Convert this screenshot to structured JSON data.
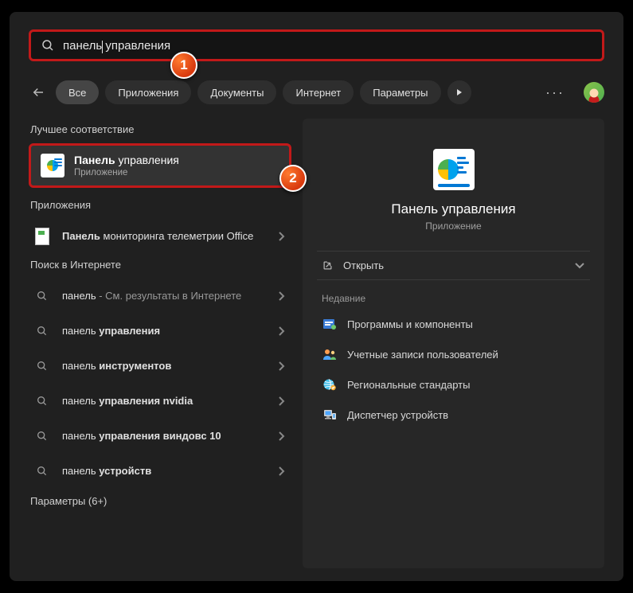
{
  "search": {
    "query_prefix": "панель",
    "query_suffix": " управления"
  },
  "tabs": {
    "all": "Все",
    "apps": "Приложения",
    "docs": "Документы",
    "web": "Интернет",
    "settings": "Параметры"
  },
  "sections": {
    "best": "Лучшее соответствие",
    "apps": "Приложения",
    "web": "Поиск в Интернете",
    "settings_count": "Параметры (6+)"
  },
  "best_match": {
    "title_bold": "Панель",
    "title_rest": " управления",
    "subtitle": "Приложение"
  },
  "apps_results": [
    {
      "bold": "Панель",
      "rest": " мониторинга телеметрии Office"
    }
  ],
  "web_results": [
    {
      "plain": "панель",
      "dim": " - См. результаты в Интернете"
    },
    {
      "plain": "панель ",
      "bold": "управления"
    },
    {
      "plain": "панель ",
      "bold": "инструментов"
    },
    {
      "plain": "панель ",
      "bold": "управления nvidia"
    },
    {
      "plain": "панель ",
      "bold": "управления виндовс 10"
    },
    {
      "plain": "панель ",
      "bold": "устройств"
    }
  ],
  "right_panel": {
    "title": "Панель управления",
    "subtitle": "Приложение",
    "open_label": "Открыть",
    "recent_label": "Недавние",
    "recent_items": [
      "Программы и компоненты",
      "Учетные записи пользователей",
      "Региональные стандарты",
      "Диспетчер устройств"
    ]
  },
  "badges": {
    "b1": "1",
    "b2": "2"
  }
}
